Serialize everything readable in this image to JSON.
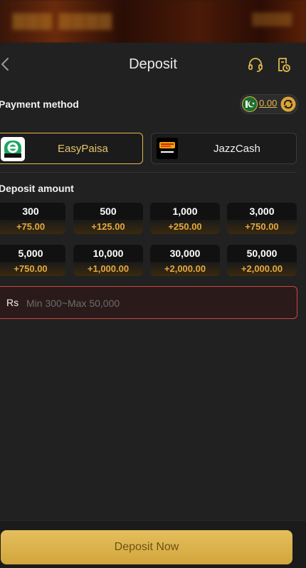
{
  "page": {
    "title": "Deposit"
  },
  "labels": {
    "payment_method": "Payment method",
    "deposit_amount": "Deposit amount"
  },
  "balance": {
    "value": "0.00"
  },
  "methods": [
    {
      "name": "EasyPaisa",
      "active": true
    },
    {
      "name": "JazzCash",
      "active": false
    }
  ],
  "amounts": [
    {
      "value": "300",
      "bonus": "+75.00"
    },
    {
      "value": "500",
      "bonus": "+125.00"
    },
    {
      "value": "1,000",
      "bonus": "+250.00"
    },
    {
      "value": "3,000",
      "bonus": "+750.00"
    },
    {
      "value": "5,000",
      "bonus": "+750.00"
    },
    {
      "value": "10,000",
      "bonus": "+1,000.00"
    },
    {
      "value": "30,000",
      "bonus": "+2,000.00"
    },
    {
      "value": "50,000",
      "bonus": "+2,000.00"
    }
  ],
  "amount_input": {
    "prefix": "Rs",
    "placeholder": "Min 300~Max 50,000"
  },
  "cta": {
    "label": "Deposit Now"
  },
  "colors": {
    "accent": "#e0b84d",
    "bonus": "#e5a93e",
    "error_border": "#d2453d"
  }
}
